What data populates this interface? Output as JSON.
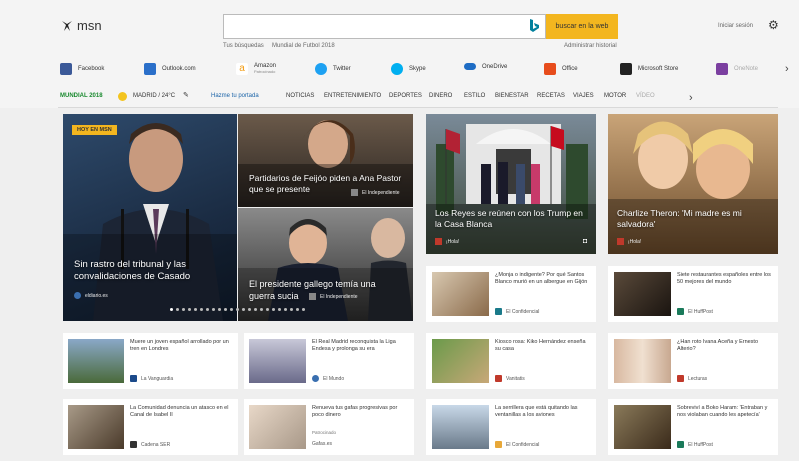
{
  "header": {
    "logo_text": "msn",
    "search_placeholder": "",
    "search_button": "buscar en la web",
    "sub_left_1": "Tus búsquedas",
    "sub_left_2": "Mundial de Futbol 2018",
    "sub_right": "Administrar historial",
    "signin": "Iniciar sesión"
  },
  "apps": [
    {
      "label": "Facebook",
      "icon": "facebook-icon",
      "color": "#3b5998"
    },
    {
      "label": "Outlook.com",
      "icon": "outlook-icon",
      "color": "#2a6fc9"
    },
    {
      "label": "Amazon",
      "sub": "Patrocinado",
      "icon": "amazon-icon",
      "color": "#f39c12"
    },
    {
      "label": "Twitter",
      "icon": "twitter-icon",
      "color": "#1da1f2"
    },
    {
      "label": "Skype",
      "icon": "skype-icon",
      "color": "#00aff0"
    },
    {
      "label": "OneDrive",
      "icon": "onedrive-icon",
      "color": "#1e6cc4"
    },
    {
      "label": "Office",
      "icon": "office-icon",
      "color": "#e74c1c"
    },
    {
      "label": "Microsoft Store",
      "icon": "store-icon",
      "color": "#222222"
    },
    {
      "label": "OneNote",
      "icon": "onenote-icon",
      "color": "#7b3fa0"
    }
  ],
  "nav": {
    "mundial": "MUNDIAL 2018",
    "weather": "MADRID / 24°C",
    "home_link": "Hazme tu portada",
    "items": [
      "NOTICIAS",
      "ENTRETENIMIENTO",
      "DEPORTES",
      "DINERO",
      "ESTILO",
      "BIENESTAR",
      "RECETAS",
      "VIAJES",
      "MOTOR",
      "VÍDEO"
    ]
  },
  "hero": {
    "badge": "HOY EN MSN",
    "main_title": "Sin rastro del tribunal y las convalidaciones de Casado",
    "main_source": "eldiario.es",
    "top_right_title": "Partidarios de Feijóo piden a Ana Pastor que se presente",
    "top_right_source": "El Independiente",
    "bottom_right_title": "El presidente gallego temía una guerra sucia",
    "bottom_right_source": "El Independiente"
  },
  "features": [
    {
      "title": "Los Reyes se reúnen con los Trump en la Casa Blanca",
      "source": "¡Hola!"
    },
    {
      "title": "Charlize Theron: 'Mi madre es mi salvadora'",
      "source": "¡Hola!"
    }
  ],
  "cards": [
    {
      "title": "¿Monja o indigente? Por qué Santos Blanco murió en un albergue en Gijón",
      "source": "El Confidencial"
    },
    {
      "title": "Siete restaurantes españoles entre los 50 mejores del mundo",
      "source": "El HuffPost"
    },
    {
      "title": "Muere un joven español arrollado por un tren en Londres",
      "source": "La Vanguardia"
    },
    {
      "title": "El Real Madrid reconquista la Liga Endesa y prolonga su era",
      "source": "El Mundo"
    },
    {
      "title": "Kiosco rosa: Kiko Hernández enseña su casa",
      "source": "Vanitatis"
    },
    {
      "title": "¿Han roto Ivana Aceña y Ernesto Alterio?",
      "source": "Lecturas"
    },
    {
      "title": "La Comunidad denuncia un atasco en el Canal de Isabel II",
      "source": "Cadena SER"
    },
    {
      "title": "Renueva tus gafas progresivas por poco dinero",
      "source": "Gafas.es",
      "sponsored": "Patrocinado"
    },
    {
      "title": "La serrillera que está quitando las ventanillas a los aviones",
      "source": "El Confidencial"
    },
    {
      "title": "Sobreviví a Boko Haram: 'Entraban y nos violaban cuando les apetecía'",
      "source": "El HuffPost"
    }
  ]
}
